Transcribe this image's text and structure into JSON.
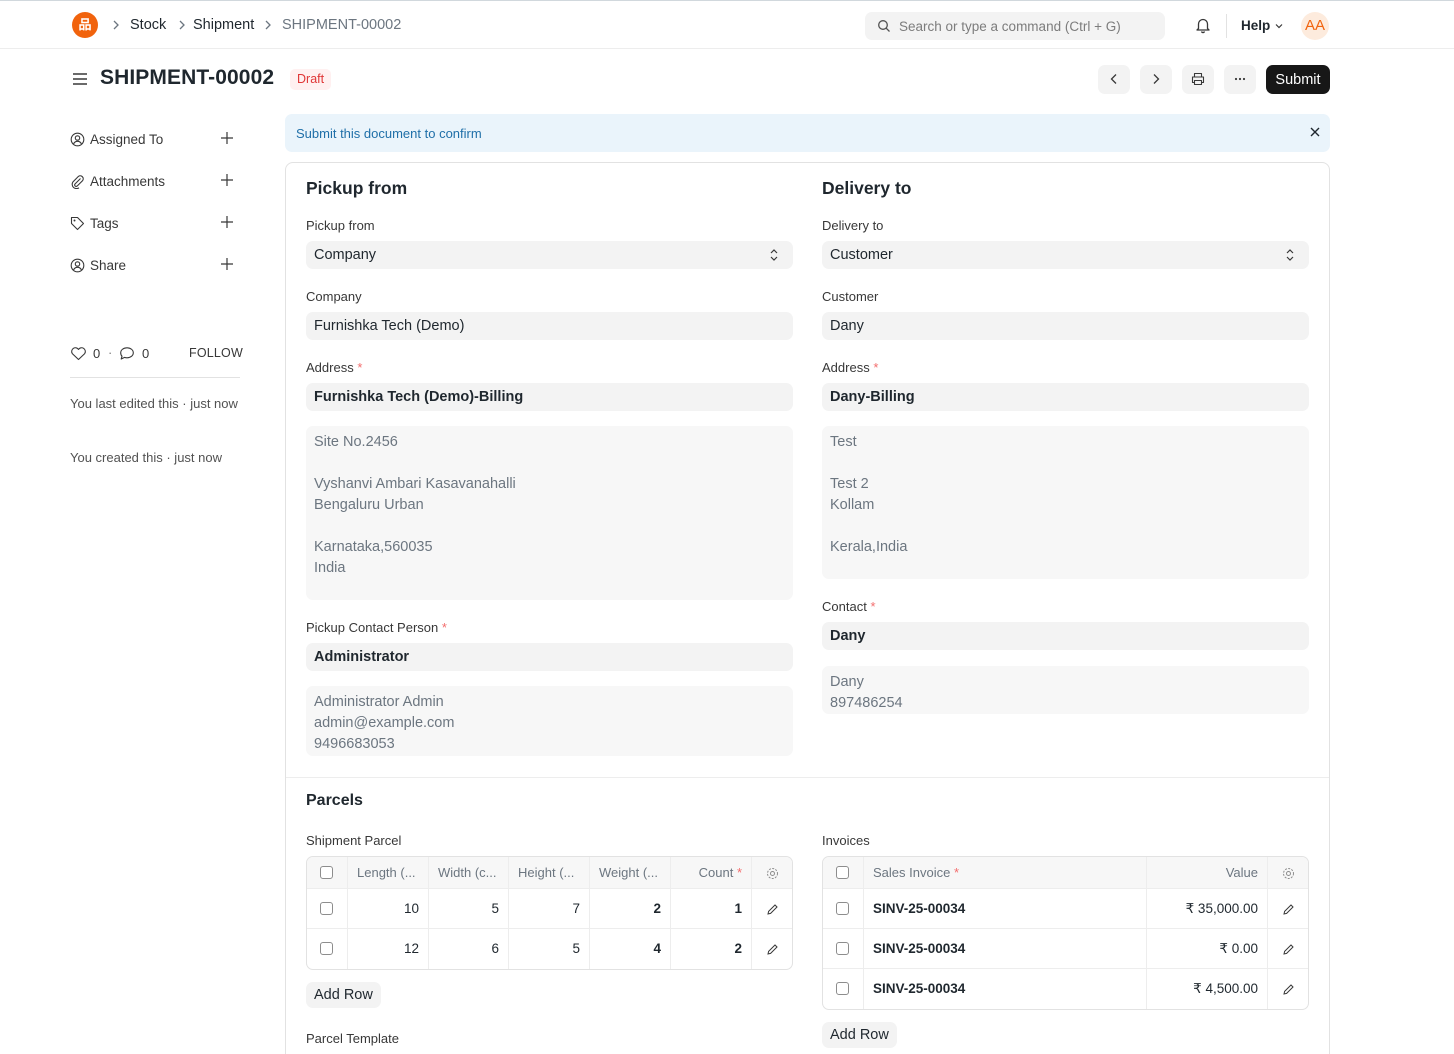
{
  "navbar": {
    "logo_letter": "品",
    "breadcrumbs": [
      "Stock",
      "Shipment",
      "SHIPMENT-00002"
    ],
    "search_placeholder": "Search or type a command (Ctrl + G)",
    "help_label": "Help",
    "avatar_initials": "AA"
  },
  "page": {
    "title": "SHIPMENT-00002",
    "status": "Draft",
    "submit_label": "Submit"
  },
  "sidebar": {
    "items": [
      {
        "label": "Assigned To",
        "icon": "assign-icon"
      },
      {
        "label": "Attachments",
        "icon": "paperclip-icon"
      },
      {
        "label": "Tags",
        "icon": "tag-icon"
      },
      {
        "label": "Share",
        "icon": "share-icon"
      }
    ],
    "likes_count": "0",
    "comments_count": "0",
    "follow_label": "FOLLOW",
    "last_edited": "You last edited this · just now",
    "created": "You created this · just now"
  },
  "alert": {
    "message": "Submit this document to confirm"
  },
  "pickup": {
    "heading": "Pickup from",
    "pickup_from_label": "Pickup from",
    "pickup_from_value": "Company",
    "company_label": "Company",
    "company_value": "Furnishka Tech (Demo)",
    "address_label": "Address",
    "address_value": "Furnishka Tech (Demo)-Billing",
    "address_display": "Site No.2456\n\nVyshanvi Ambari Kasavanahalli\nBengaluru Urban\n\nKarnataka,560035\nIndia",
    "contact_label": "Pickup Contact Person",
    "contact_value": "Administrator",
    "contact_display": "Administrator Admin\nadmin@example.com\n9496683053"
  },
  "delivery": {
    "heading": "Delivery to",
    "delivery_to_label": "Delivery to",
    "delivery_to_value": "Customer",
    "customer_label": "Customer",
    "customer_value": "Dany",
    "address_label": "Address",
    "address_value": "Dany-Billing",
    "address_display": "Test\n\nTest 2\nKollam\n\nKerala,India",
    "contact_label": "Contact",
    "contact_value": "Dany",
    "contact_display": "Dany\n897486254"
  },
  "parcels": {
    "heading": "Parcels",
    "shipment_parcel_label": "Shipment Parcel",
    "parcel_columns": [
      "Length (...",
      "Width (c...",
      "Height (...",
      "Weight (...",
      "Count"
    ],
    "parcel_rows": [
      [
        "10",
        "5",
        "7",
        "2",
        "1"
      ],
      [
        "12",
        "6",
        "5",
        "4",
        "2"
      ]
    ],
    "add_row_label": "Add Row",
    "parcel_template_label": "Parcel Template",
    "invoices_label": "Invoices",
    "invoice_columns": [
      "Sales Invoice",
      "Value"
    ],
    "invoice_rows": [
      [
        "SINV-25-00034",
        "₹ 35,000.00"
      ],
      [
        "SINV-25-00034",
        "₹ 0.00"
      ],
      [
        "SINV-25-00034",
        "₹ 4,500.00"
      ]
    ]
  },
  "colors": {
    "brand": "#f1630d",
    "draft_text": "#e03636",
    "draft_bg": "#fff0f0",
    "alert_bg": "#eaf4fb",
    "alert_text": "#1f6fa8",
    "primary_button": "#171717"
  }
}
